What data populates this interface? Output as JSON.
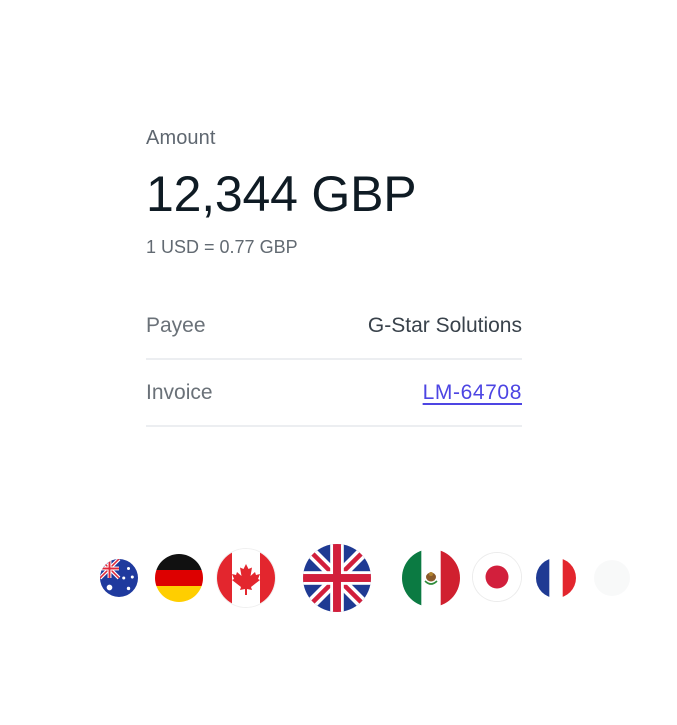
{
  "amount": {
    "label": "Amount",
    "value": "12,344 GBP",
    "rate": "1 USD = 0.77 GBP"
  },
  "details": [
    {
      "key": "Payee",
      "value": "G-Star Solutions",
      "is_link": false
    },
    {
      "key": "Invoice",
      "value": "LM-64708",
      "is_link": true
    }
  ],
  "colors": {
    "link": "#4d45e3",
    "heading": "#0f1b24",
    "muted": "#5f6770"
  },
  "flags": [
    {
      "name": "australia-flag-icon"
    },
    {
      "name": "germany-flag-icon"
    },
    {
      "name": "canada-flag-icon"
    },
    {
      "name": "united-kingdom-flag-icon",
      "selected": true
    },
    {
      "name": "mexico-flag-icon"
    },
    {
      "name": "japan-flag-icon"
    },
    {
      "name": "france-flag-icon"
    },
    {
      "name": "faded-flag-icon"
    }
  ]
}
